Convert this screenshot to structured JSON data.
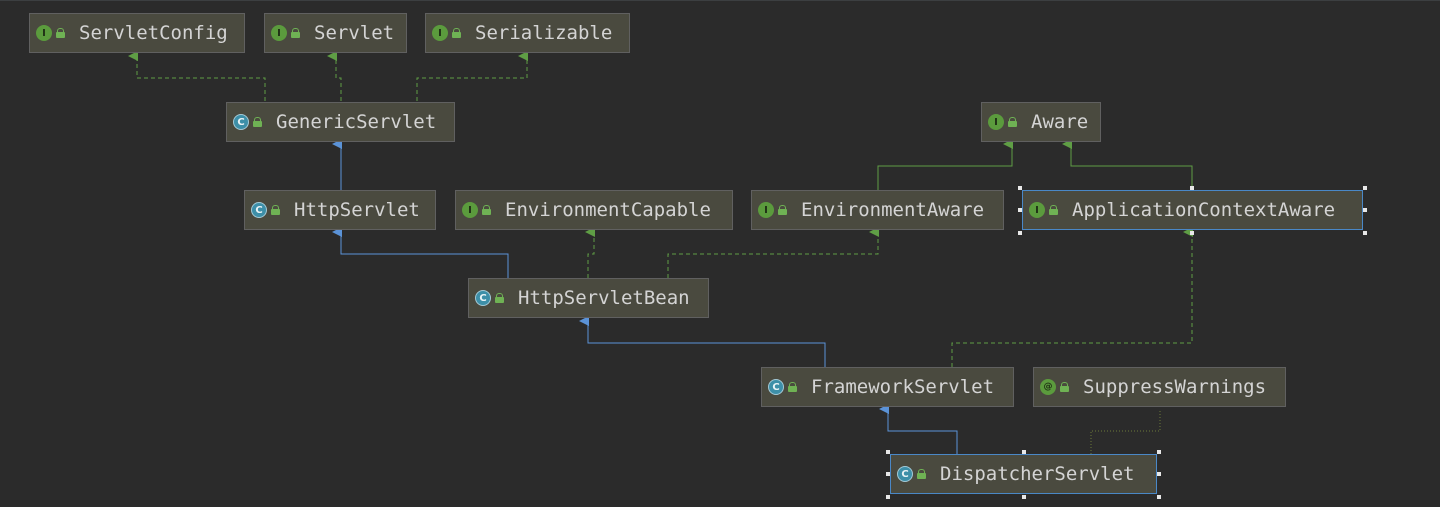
{
  "diagram": {
    "nodes": {
      "servlet_config": {
        "name": "ServletConfig",
        "kind": "interface",
        "kind_glyph": "I"
      },
      "servlet": {
        "name": "Servlet",
        "kind": "interface",
        "kind_glyph": "I"
      },
      "serializable": {
        "name": "Serializable",
        "kind": "interface",
        "kind_glyph": "I"
      },
      "generic_servlet": {
        "name": "GenericServlet",
        "kind": "abstract-class",
        "kind_glyph": "C"
      },
      "aware": {
        "name": "Aware",
        "kind": "interface",
        "kind_glyph": "I"
      },
      "http_servlet": {
        "name": "HttpServlet",
        "kind": "abstract-class",
        "kind_glyph": "C"
      },
      "environment_capable": {
        "name": "EnvironmentCapable",
        "kind": "interface",
        "kind_glyph": "I"
      },
      "environment_aware": {
        "name": "EnvironmentAware",
        "kind": "interface",
        "kind_glyph": "I"
      },
      "application_context_aware": {
        "name": "ApplicationContextAware",
        "kind": "interface",
        "kind_glyph": "I"
      },
      "http_servlet_bean": {
        "name": "HttpServletBean",
        "kind": "abstract-class",
        "kind_glyph": "C"
      },
      "framework_servlet": {
        "name": "FrameworkServlet",
        "kind": "abstract-class",
        "kind_glyph": "C"
      },
      "suppress_warnings": {
        "name": "SuppressWarnings",
        "kind": "annotation",
        "kind_glyph": "@"
      },
      "dispatcher_servlet": {
        "name": "DispatcherServlet",
        "kind": "class",
        "kind_glyph": "C"
      }
    },
    "edges": [
      {
        "from": "generic_servlet",
        "to": "servlet_config",
        "type": "implements"
      },
      {
        "from": "generic_servlet",
        "to": "servlet",
        "type": "implements"
      },
      {
        "from": "generic_servlet",
        "to": "serializable",
        "type": "implements"
      },
      {
        "from": "http_servlet",
        "to": "generic_servlet",
        "type": "extends"
      },
      {
        "from": "environment_aware",
        "to": "aware",
        "type": "extends-interface"
      },
      {
        "from": "application_context_aware",
        "to": "aware",
        "type": "extends-interface"
      },
      {
        "from": "http_servlet_bean",
        "to": "http_servlet",
        "type": "extends"
      },
      {
        "from": "http_servlet_bean",
        "to": "environment_capable",
        "type": "implements"
      },
      {
        "from": "http_servlet_bean",
        "to": "environment_aware",
        "type": "implements"
      },
      {
        "from": "framework_servlet",
        "to": "http_servlet_bean",
        "type": "extends"
      },
      {
        "from": "framework_servlet",
        "to": "application_context_aware",
        "type": "implements"
      },
      {
        "from": "dispatcher_servlet",
        "to": "framework_servlet",
        "type": "extends"
      },
      {
        "from": "dispatcher_servlet",
        "to": "suppress_warnings",
        "type": "annotated-by"
      }
    ],
    "selected": [
      "application_context_aware",
      "dispatcher_servlet"
    ],
    "colors": {
      "background": "#2b2b2b",
      "node_fill": "#4a4a3f",
      "node_border": "#606060",
      "selected_border": "#4a88c7",
      "extends_edge": "#5b93d8",
      "implements_edge": "#5f9e45",
      "annotation_edge": "#6b7a3a",
      "text": "#d4d4d4"
    }
  }
}
